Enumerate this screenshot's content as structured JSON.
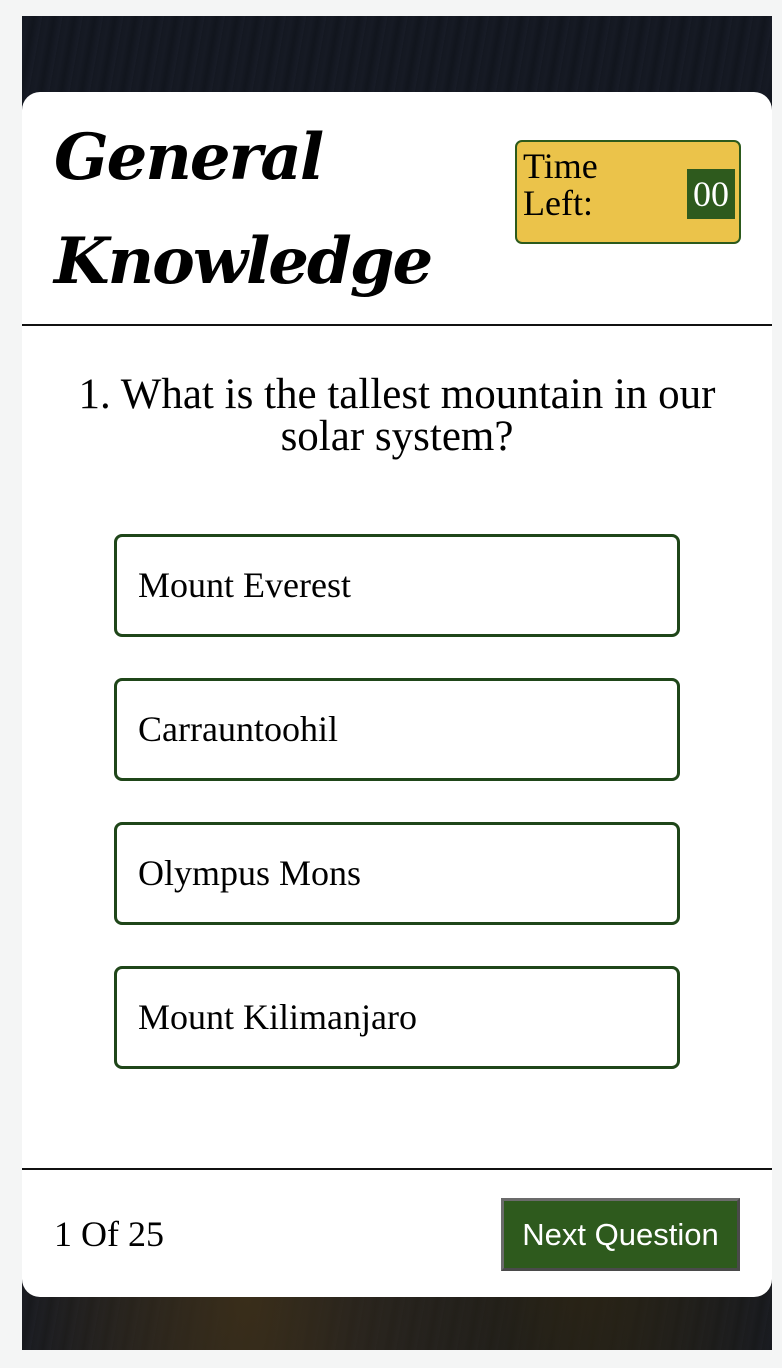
{
  "header": {
    "title_line1": "General",
    "title_line2": "Knowledge",
    "timer_label_line1": "Time",
    "timer_label_line2": "Left:",
    "timer_value": "00"
  },
  "question": {
    "text": "1. What is the tallest mountain in our solar system?"
  },
  "answers": [
    {
      "label": "Mount Everest"
    },
    {
      "label": "Carrauntoohil"
    },
    {
      "label": "Olympus Mons"
    },
    {
      "label": "Mount Kilimanjaro"
    }
  ],
  "footer": {
    "progress": "1 Of 25",
    "next_label": "Next Question"
  },
  "colors": {
    "accent_green": "#2e5a1d",
    "timer_yellow": "#ebc34a",
    "answer_border": "#1f4619"
  }
}
